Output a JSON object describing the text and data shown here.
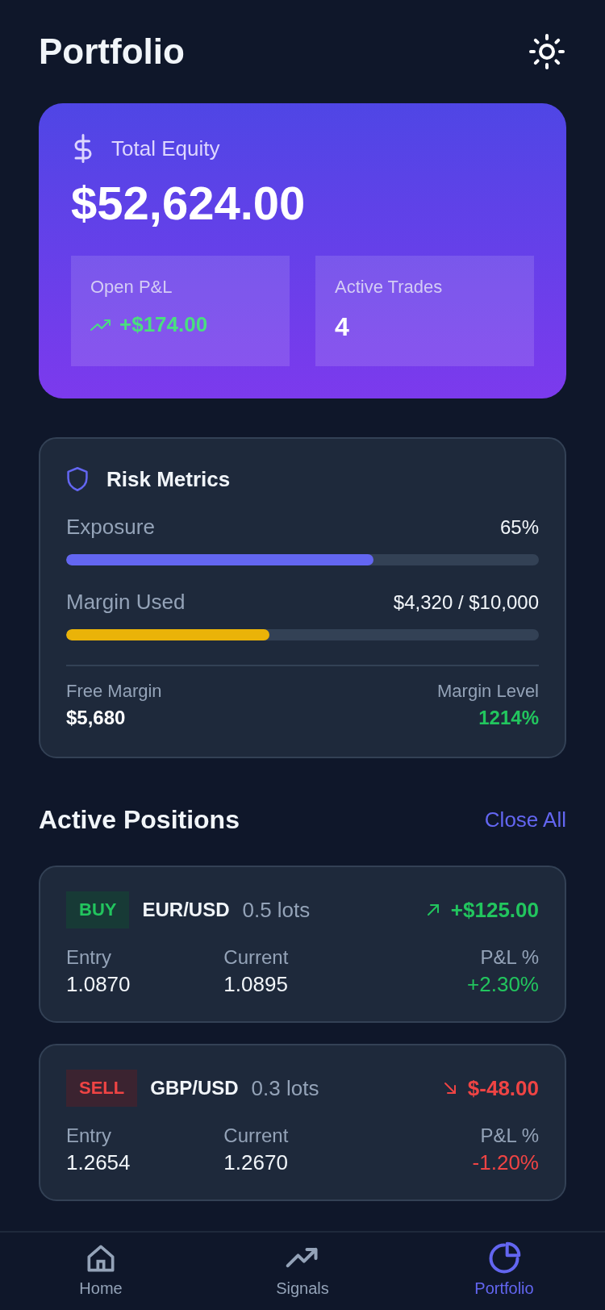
{
  "header": {
    "title": "Portfolio"
  },
  "equity": {
    "label": "Total Equity",
    "value": "$52,624.00",
    "stats": [
      {
        "label": "Open P&L",
        "value": "+$174.00",
        "kind": "pnl"
      },
      {
        "label": "Active Trades",
        "value": "4",
        "kind": "plain"
      }
    ]
  },
  "risk": {
    "title": "Risk Metrics",
    "meters": [
      {
        "label": "Exposure",
        "reading": "65%",
        "level": 0.65,
        "color": "#6366f1"
      },
      {
        "label": "Margin Used",
        "reading": "$4,320 / $10,000",
        "level": 0.43,
        "color": "#eab308"
      }
    ],
    "footer": [
      {
        "label": "Free Margin",
        "value": "$5,680",
        "kind": "plain"
      },
      {
        "label": "Margin Level",
        "value": "1214%",
        "kind": "positive"
      }
    ]
  },
  "positions": {
    "title": "Active Positions",
    "action": "Close All",
    "items": [
      {
        "side": "BUY",
        "kind": "buy",
        "pair": "EUR/USD",
        "size": "0.5 lots",
        "pnl": "+$125.00",
        "entry_label": "Entry",
        "entry": "1.0870",
        "current_label": "Current",
        "current": "1.0895",
        "pct_label": "P&L %",
        "pct": "+2.30%"
      },
      {
        "side": "SELL",
        "kind": "sell",
        "pair": "GBP/USD",
        "size": "0.3 lots",
        "pnl": "$-48.00",
        "entry_label": "Entry",
        "entry": "1.2654",
        "current_label": "Current",
        "current": "1.2670",
        "pct_label": "P&L %",
        "pct": "-1.20%"
      }
    ]
  },
  "nav": [
    {
      "label": "Home",
      "selected": false
    },
    {
      "label": "Signals",
      "selected": false
    },
    {
      "label": "Portfolio",
      "selected": true
    }
  ]
}
